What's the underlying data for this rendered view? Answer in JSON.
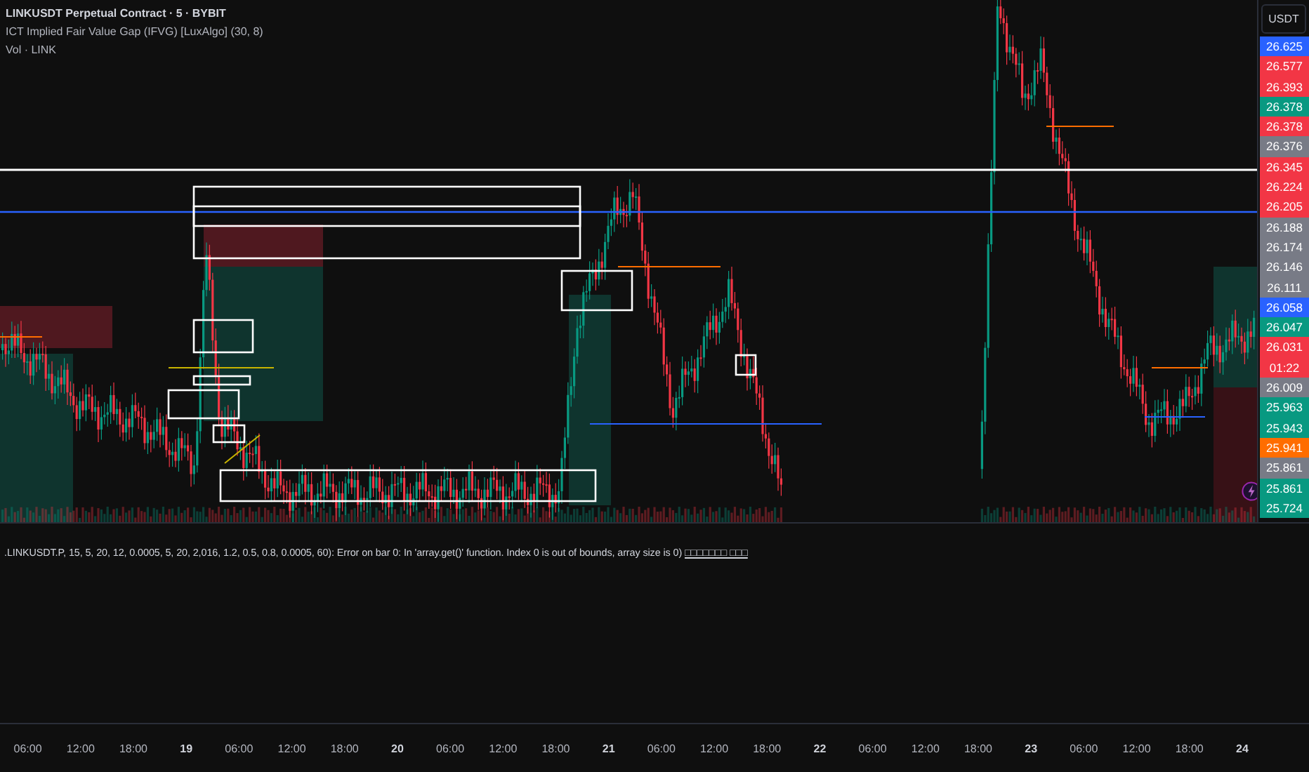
{
  "legend": {
    "symbol": "LINKUSDT Perpetual Contract · 5 · BYBIT",
    "indicators": [
      "ICT Implied Fair Value Gap (IFVG) [LuxAlgo] (30, 8)",
      "Vol · LINK"
    ]
  },
  "currency_button": "USDT",
  "price_labels": [
    {
      "price": "26.625",
      "color": "#2962ff"
    },
    {
      "price": "26.577",
      "color": "#f23645"
    },
    {
      "price": "26.393",
      "color": "#f23645"
    },
    {
      "price": "26.378",
      "color": "#089981"
    },
    {
      "price": "26.378",
      "color": "#f23645"
    },
    {
      "price": "26.376",
      "color": "#787b86"
    },
    {
      "price": "26.345",
      "color": "#f23645"
    },
    {
      "price": "26.224",
      "color": "#f23645"
    },
    {
      "price": "26.205",
      "color": "#f23645"
    },
    {
      "price": "26.188",
      "color": "#787b86"
    },
    {
      "price": "26.174",
      "color": "#787b86"
    },
    {
      "price": "26.146",
      "color": "#787b86"
    },
    {
      "price": "26.111",
      "color": "#787b86"
    },
    {
      "price": "26.058",
      "color": "#2962ff"
    },
    {
      "price": "26.047",
      "color": "#089981"
    },
    {
      "price": "26.031",
      "color": "#f23645",
      "countdown": "01:22"
    },
    {
      "price": "26.009",
      "color": "#787b86"
    },
    {
      "price": "25.963",
      "color": "#089981"
    },
    {
      "price": "25.943",
      "color": "#089981"
    },
    {
      "price": "25.941",
      "color": "#ff6d00"
    },
    {
      "price": "25.861",
      "color": "#787b86"
    },
    {
      "price": "25.861",
      "color": "#089981"
    },
    {
      "price": "25.724",
      "color": "#089981"
    }
  ],
  "error_pane": {
    "message": ".LINKUSDT.P, 15, 5, 20, 12, 0.0005, 5, 20, 2,016, 1.2, 0.5, 0.8, 0.0005, 60): Error on bar 0: In 'array.get()' function. Index 0 is out of bounds, array size is 0)",
    "link": "□□□□□□□ □□□"
  },
  "time_axis": [
    {
      "label": "06:00",
      "kind": "time"
    },
    {
      "label": "12:00",
      "kind": "time"
    },
    {
      "label": "18:00",
      "kind": "time"
    },
    {
      "label": "19",
      "kind": "day"
    },
    {
      "label": "06:00",
      "kind": "time"
    },
    {
      "label": "12:00",
      "kind": "time"
    },
    {
      "label": "18:00",
      "kind": "time"
    },
    {
      "label": "20",
      "kind": "day"
    },
    {
      "label": "06:00",
      "kind": "time"
    },
    {
      "label": "12:00",
      "kind": "time"
    },
    {
      "label": "18:00",
      "kind": "time"
    },
    {
      "label": "21",
      "kind": "day"
    },
    {
      "label": "06:00",
      "kind": "time"
    },
    {
      "label": "12:00",
      "kind": "time"
    },
    {
      "label": "18:00",
      "kind": "time"
    },
    {
      "label": "22",
      "kind": "day"
    },
    {
      "label": "06:00",
      "kind": "time"
    },
    {
      "label": "12:00",
      "kind": "time"
    },
    {
      "label": "18:00",
      "kind": "time"
    },
    {
      "label": "23",
      "kind": "day"
    },
    {
      "label": "06:00",
      "kind": "time"
    },
    {
      "label": "12:00",
      "kind": "time"
    },
    {
      "label": "18:00",
      "kind": "time"
    },
    {
      "label": "24",
      "kind": "day"
    }
  ]
}
